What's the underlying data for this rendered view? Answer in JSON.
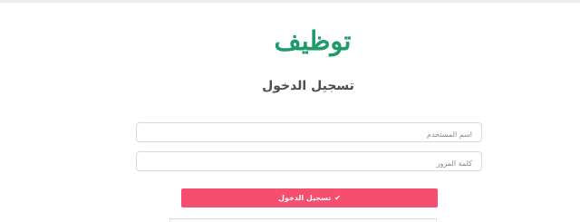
{
  "brand": {
    "logo_text": "توظيف",
    "logo_color": "#1f9b6b"
  },
  "page_title": "تسجيل الدخول",
  "form": {
    "username": {
      "placeholder": "اسم المستخدم",
      "value": ""
    },
    "password": {
      "placeholder": "كلمة المرور",
      "value": ""
    },
    "submit_label": "تسجيل الدخول",
    "submit_icon": "check-icon"
  },
  "colors": {
    "button": "#f64e6e",
    "title": "#4e4e4e",
    "border": "#d9d9d9"
  }
}
